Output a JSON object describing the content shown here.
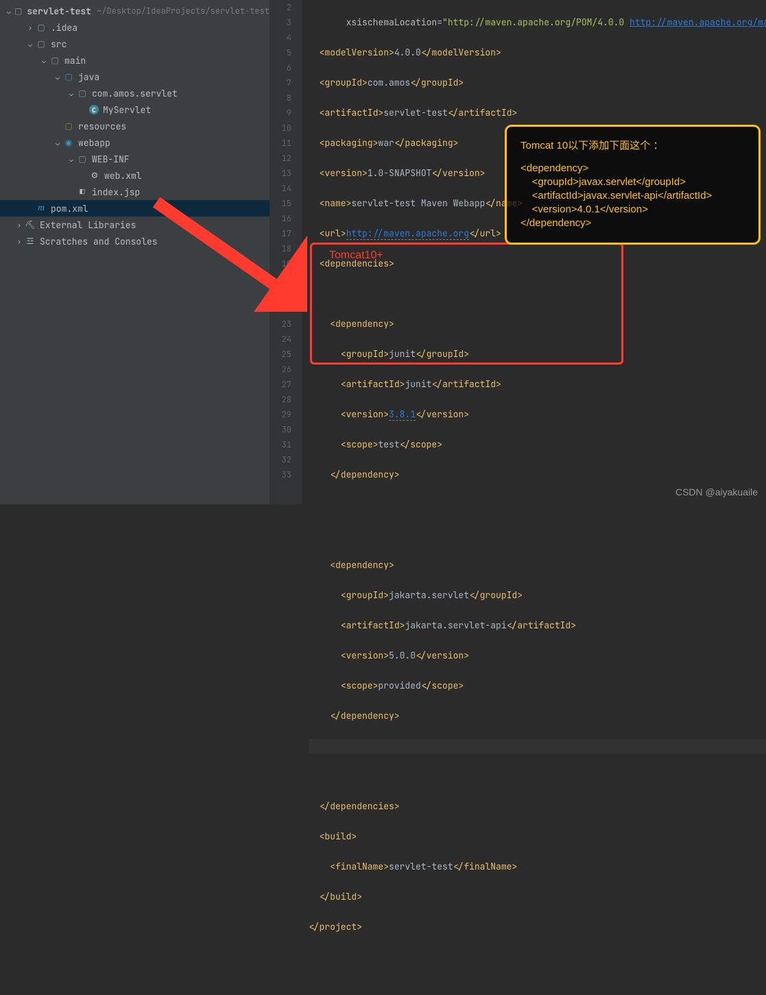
{
  "project": {
    "name": "servlet-test",
    "path": "~/Desktop/IdeaProjects/servlet-test"
  },
  "tree": {
    "idea": ".idea",
    "src": "src",
    "main": "main",
    "java": "java",
    "pkg": "com.amos.servlet",
    "cls": "MyServlet",
    "resources": "resources",
    "webapp": "webapp",
    "webinf": "WEB-INF",
    "webxml": "web.xml",
    "indexjsp": "index.jsp",
    "pom": "pom.xml",
    "extlib": "External Libraries",
    "scratches": "Scratches and Consoles"
  },
  "code": {
    "l2": {
      "a": "xsi",
      ".": ".",
      "b": "schemaLocation",
      "eq": "=",
      "v1": "\"http://maven.apache.org/POM/4.0.0 ",
      "v2": "http://maven.apache.org/mave"
    },
    "l3": {
      "o": "<modelVersion>",
      "t": "4.0.0",
      "c": "</modelVersion>"
    },
    "l4": {
      "o": "<groupId>",
      "t": "com.amos",
      "c": "</groupId>"
    },
    "l5": {
      "o": "<artifactId>",
      "t": "servlet-test",
      "c": "</artifactId>"
    },
    "l6": {
      "o": "<packaging>",
      "t": "war",
      "c": "</packaging>"
    },
    "l7": {
      "o": "<version>",
      "t": "1.0-SNAPSHOT",
      "c": "</version>"
    },
    "l8": {
      "o": "<name>",
      "t": "servlet-test Maven Webapp",
      "c": "</name>"
    },
    "l9": {
      "o": "<url>",
      "t": "http://maven.apache.org",
      "c": "</url>"
    },
    "l10": {
      "o": "<dependencies>"
    },
    "l12": {
      "o": "<dependency>"
    },
    "l13": {
      "o": "<groupId>",
      "t": "junit",
      "c": "</groupId>"
    },
    "l14": {
      "o": "<artifactId>",
      "t": "junit",
      "c": "</artifactId>"
    },
    "l15": {
      "o": "<version>",
      "t": "3.8.1",
      "c": "</version>"
    },
    "l16": {
      "o": "<scope>",
      "t": "test",
      "c": "</scope>"
    },
    "l17": {
      "o": "</dependency>"
    },
    "l20": {
      "o": "<dependency>"
    },
    "l21": {
      "o": "<groupId>",
      "t": "jakarta.servlet",
      "c": "</groupId>"
    },
    "l22": {
      "o": "<artifactId>",
      "t": "jakarta.servlet-api",
      "c": "</artifactId>"
    },
    "l23": {
      "o": "<version>",
      "t": "5.0.0",
      "c": "</version>"
    },
    "l24": {
      "o": "<scope>",
      "t": "provided",
      "c": "</scope>"
    },
    "l25": {
      "o": "</dependency>"
    },
    "l28": {
      "o": "</dependencies>"
    },
    "l29": {
      "o": "<build>"
    },
    "l30": {
      "o": "<finalName>",
      "t": "servlet-test",
      "c": "</finalName>"
    },
    "l31": {
      "o": "</build>"
    },
    "l32": {
      "o": "</project>"
    }
  },
  "annotation": {
    "red_label": "Tomcat10+",
    "orange_title": "Tomcat 10以下添加下面这个  ：",
    "orange_dep": {
      "l1": "<dependency>",
      "l2": "    <groupId>javax.servlet</groupId>",
      "l3": "    <artifactId>javax.servlet-api</artifactId>",
      "l4": "    <version>4.0.1</version>",
      "l5": "</dependency>"
    }
  },
  "watermark": "CSDN @aiyakuaile",
  "gutter_start": 2,
  "gutter_end": 33
}
